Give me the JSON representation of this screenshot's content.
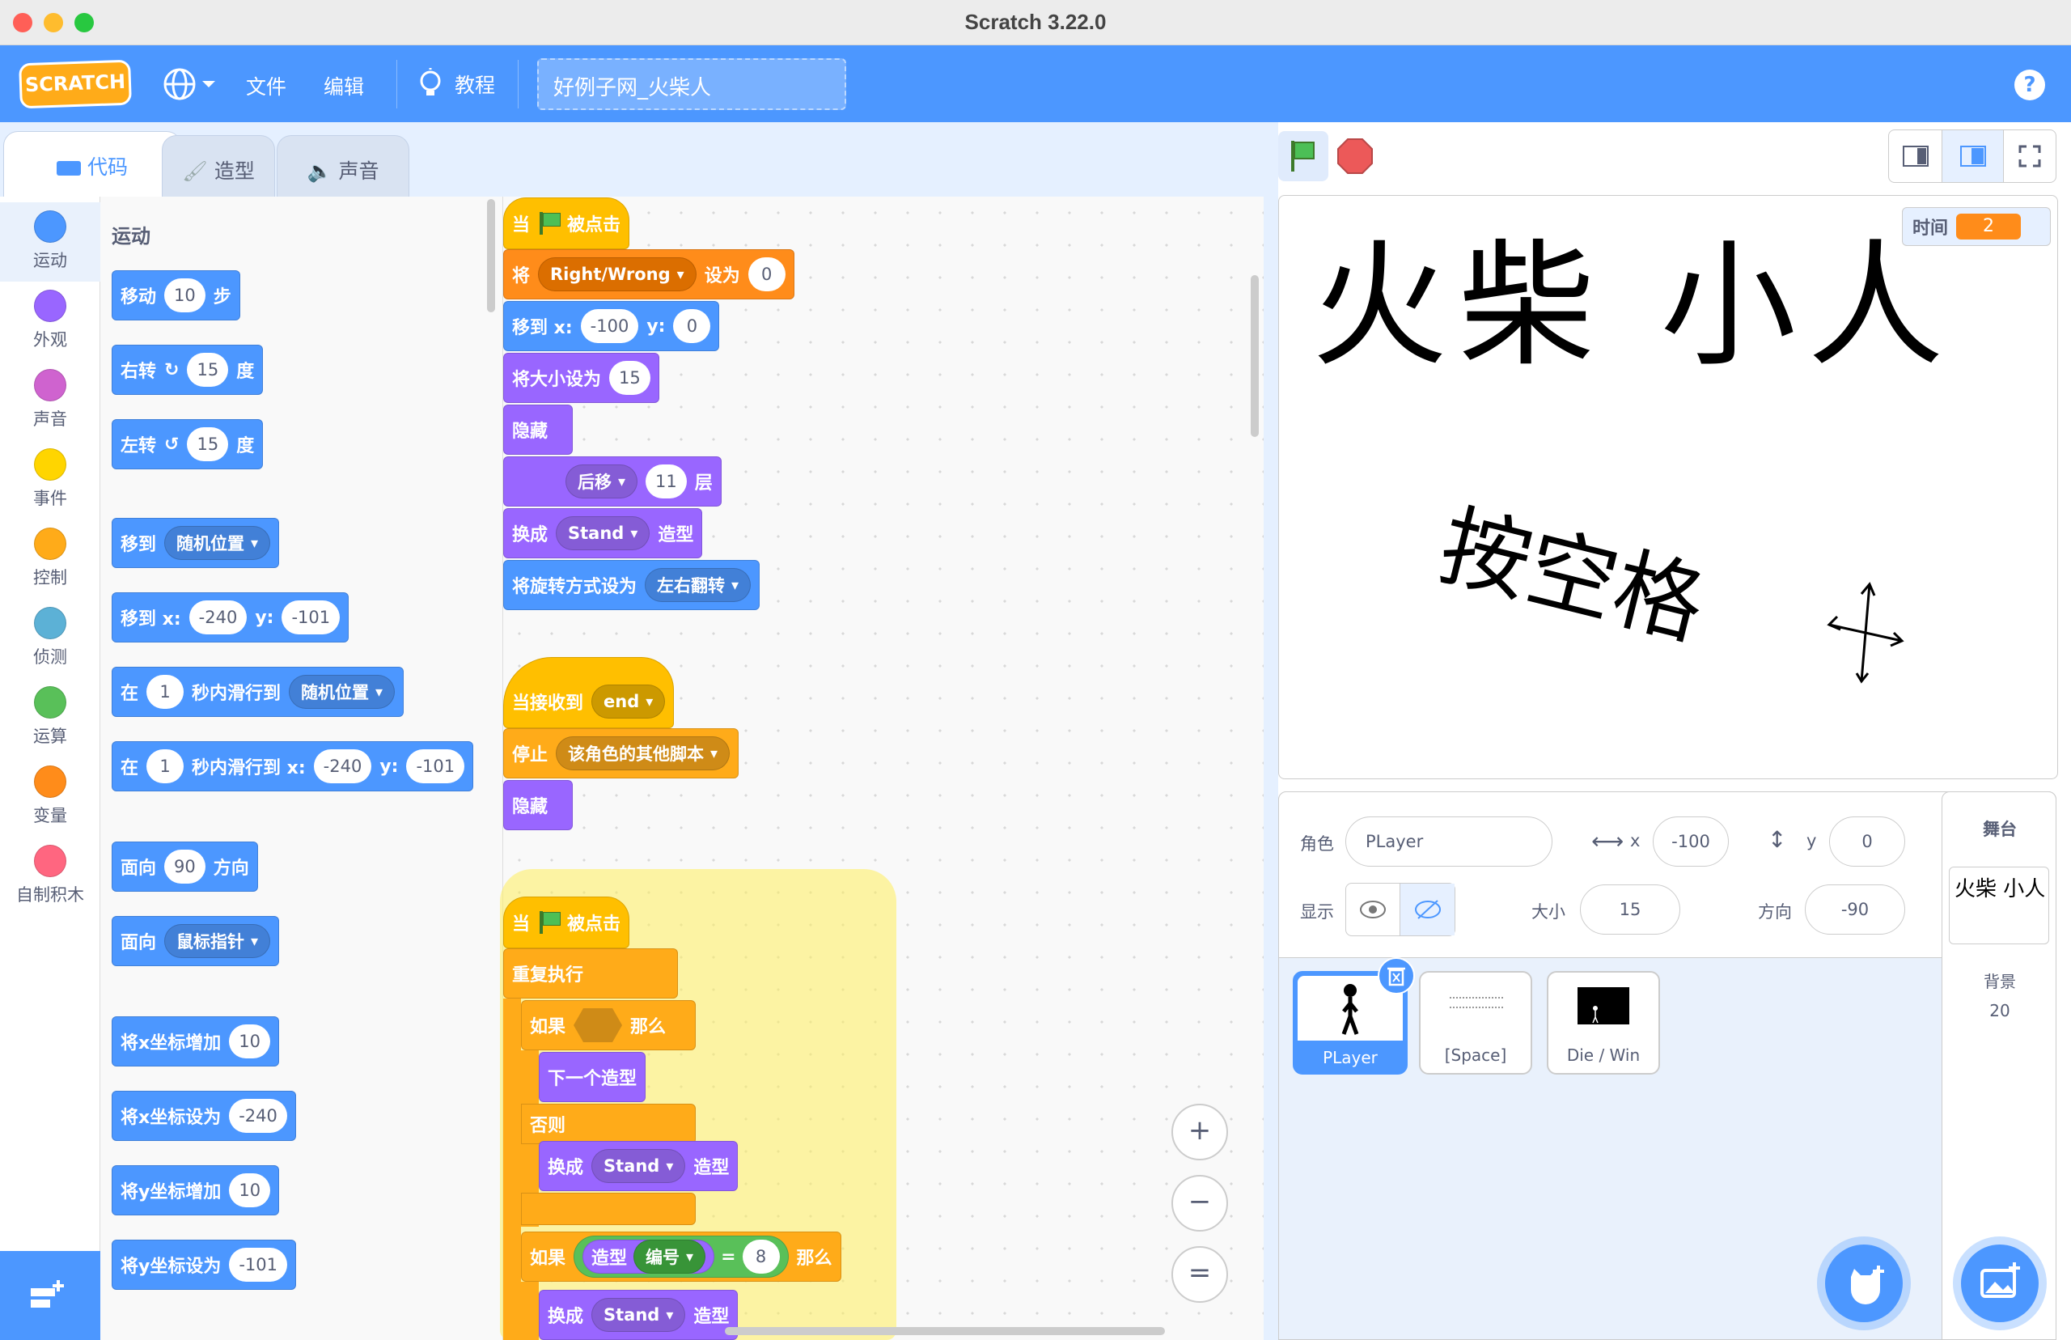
{
  "window": {
    "title": "Scratch 3.22.0"
  },
  "menu": {
    "logo": "SCRATCH",
    "file": "文件",
    "edit": "编辑",
    "tutorials": "教程",
    "project_title": "好例子网_火柴人",
    "help": "?"
  },
  "tabs": [
    {
      "label": "代码",
      "active": true
    },
    {
      "label": "造型"
    },
    {
      "label": "声音"
    }
  ],
  "categories": [
    {
      "label": "运动",
      "color": "#4c97ff"
    },
    {
      "label": "外观",
      "color": "#9966ff"
    },
    {
      "label": "声音",
      "color": "#cf63cf"
    },
    {
      "label": "事件",
      "color": "#ffd500"
    },
    {
      "label": "控制",
      "color": "#ffab19"
    },
    {
      "label": "侦测",
      "color": "#5cb1d6"
    },
    {
      "label": "运算",
      "color": "#59c059"
    },
    {
      "label": "变量",
      "color": "#ff8c1a"
    },
    {
      "label": "自制积木",
      "color": "#ff6680"
    }
  ],
  "palette": {
    "heading": "运动",
    "move": {
      "a": "移动",
      "v": "10",
      "b": "步"
    },
    "turn_right": {
      "a": "右转",
      "v": "15",
      "b": "度"
    },
    "turn_left": {
      "a": "左转",
      "v": "15",
      "b": "度"
    },
    "goto": {
      "a": "移到",
      "d": "随机位置"
    },
    "goto_xy": {
      "a": "移到 x:",
      "x": "-240",
      "y_lbl": "y:",
      "y": "-101"
    },
    "glide": {
      "a": "在",
      "v": "1",
      "b": "秒内滑行到",
      "d": "随机位置"
    },
    "glide_xy": {
      "a": "在",
      "v": "1",
      "b": "秒内滑行到 x:",
      "x": "-240",
      "y_lbl": "y:",
      "y": "-101"
    },
    "point": {
      "a": "面向",
      "v": "90",
      "b": "方向"
    },
    "point_towards": {
      "a": "面向",
      "d": "鼠标指针"
    },
    "change_x": {
      "a": "将x坐标增加",
      "v": "10"
    },
    "set_x": {
      "a": "将x坐标设为",
      "v": "-240"
    },
    "change_y": {
      "a": "将y坐标增加",
      "v": "10"
    },
    "set_y": {
      "a": "将y坐标设为",
      "v": "-101"
    }
  },
  "scripts": {
    "s1": {
      "hat": {
        "a": "当",
        "b": "被点击"
      },
      "setvar": {
        "a": "将",
        "d": "Right/Wrong",
        "b": "设为",
        "v": "0"
      },
      "goto": {
        "a": "移到 x:",
        "x": "-100",
        "y_lbl": "y:",
        "y": "0"
      },
      "size": {
        "a": "将大小设为",
        "v": "15"
      },
      "hide": "隐藏",
      "layer": {
        "d": "后移",
        "v": "11",
        "b": "层"
      },
      "costume": {
        "a": "换成",
        "d": "Stand",
        "b": "造型"
      },
      "rotation": {
        "a": "将旋转方式设为",
        "d": "左右翻转"
      }
    },
    "s2": {
      "hat": {
        "a": "当接收到",
        "d": "end"
      },
      "stop": {
        "a": "停止",
        "d": "该角色的其他脚本"
      },
      "hide": "隐藏"
    },
    "s3": {
      "hat": {
        "a": "当",
        "b": "被点击"
      },
      "forever": "重复执行",
      "if1": {
        "a": "如果",
        "b": "那么"
      },
      "next": "下一个造型",
      "else": "否则",
      "switch1": {
        "a": "换成",
        "d": "Stand",
        "b": "造型"
      },
      "if2": {
        "a": "如果",
        "c": "造型",
        "d": "编号",
        "eq": "=",
        "v": "8",
        "b": "那么"
      },
      "switch2": {
        "a": "换成",
        "d": "Stand",
        "b": "造型"
      }
    }
  },
  "zoom": {
    "in": "+",
    "out": "−",
    "reset": "="
  },
  "stage": {
    "monitor": {
      "label": "时间",
      "value": "2"
    },
    "big_text": "火柴 小人",
    "hint": "按空格"
  },
  "sprite_info": {
    "sprite_label": "角色",
    "sprite_name": "PLayer",
    "x_label": "x",
    "x": "-100",
    "y_label": "y",
    "y": "0",
    "show_label": "显示",
    "size_label": "大小",
    "size": "15",
    "dir_label": "方向",
    "dir": "-90"
  },
  "sprites": [
    {
      "name": "PLayer",
      "selected": true
    },
    {
      "name": "[Space]"
    },
    {
      "name": "Die / Win"
    }
  ],
  "stage_pane": {
    "title": "舞台",
    "backdrop_label": "背景",
    "backdrop_count": "20",
    "thumb_text": "火柴 小人"
  }
}
